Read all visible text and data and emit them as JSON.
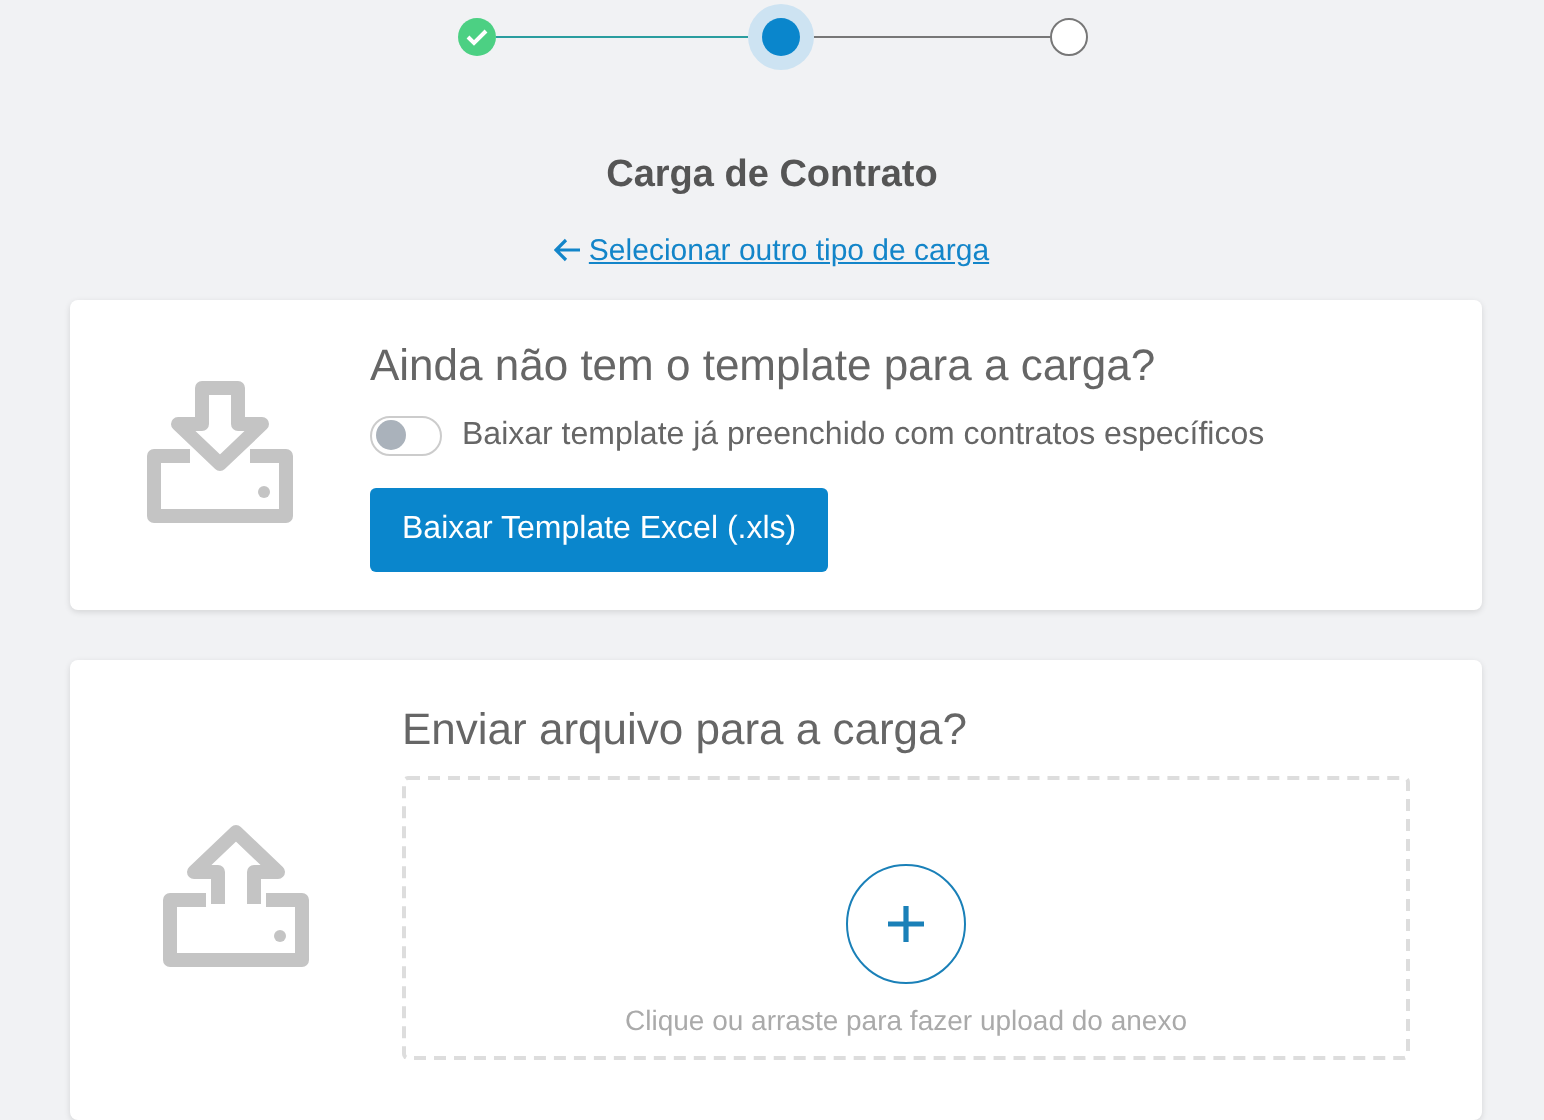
{
  "stepper": [
    {
      "kind": "done"
    },
    {
      "kind": "current"
    },
    {
      "kind": "pending"
    }
  ],
  "title": "Carga de Contrato",
  "back_link": "Selecionar outro tipo de carga",
  "template_card": {
    "heading": "Ainda não tem o template para a carga?",
    "toggle": {
      "label": "Baixar template já preenchido com contratos específicos",
      "on": false
    },
    "button": "Baixar Template Excel (.xls)"
  },
  "upload_card": {
    "heading": "Enviar arquivo para a carga?",
    "dropzone_hint": "Clique ou arraste para fazer upload do anexo"
  }
}
